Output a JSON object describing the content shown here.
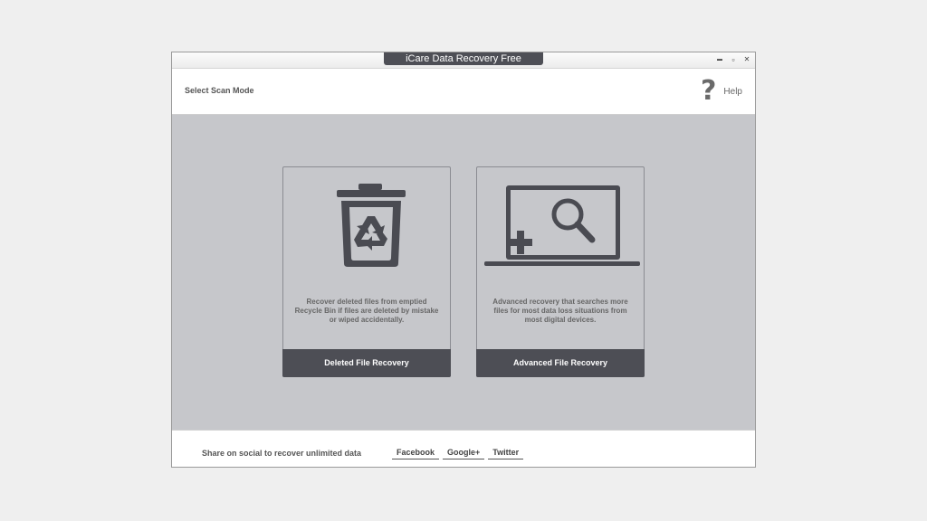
{
  "window": {
    "title": "iCare Data Recovery Free",
    "controls": {
      "minimize": "▬",
      "maximize": "▫",
      "close": "✕"
    }
  },
  "header": {
    "scan_mode_label": "Select Scan Mode",
    "help_icon": "?",
    "help_label": "Help"
  },
  "cards": [
    {
      "icon": "recycle-bin-icon",
      "description": "Recover deleted files from emptied Recycle Bin if files are deleted by mistake or wiped accidentally.",
      "button_label": "Deleted File Recovery"
    },
    {
      "icon": "laptop-search-icon",
      "description": "Advanced recovery that searches more files for most data loss situations from most digital devices.",
      "button_label": "Advanced File Recovery"
    }
  ],
  "footer": {
    "share_text": "Share on social to recover unlimited data",
    "links": [
      "Facebook",
      "Google+",
      "Twitter"
    ]
  },
  "colors": {
    "title_tab": "#4e4f56",
    "card_button": "#4d4e55",
    "main_bg": "#c6c7cb",
    "icon_dark": "#4a4b52"
  }
}
